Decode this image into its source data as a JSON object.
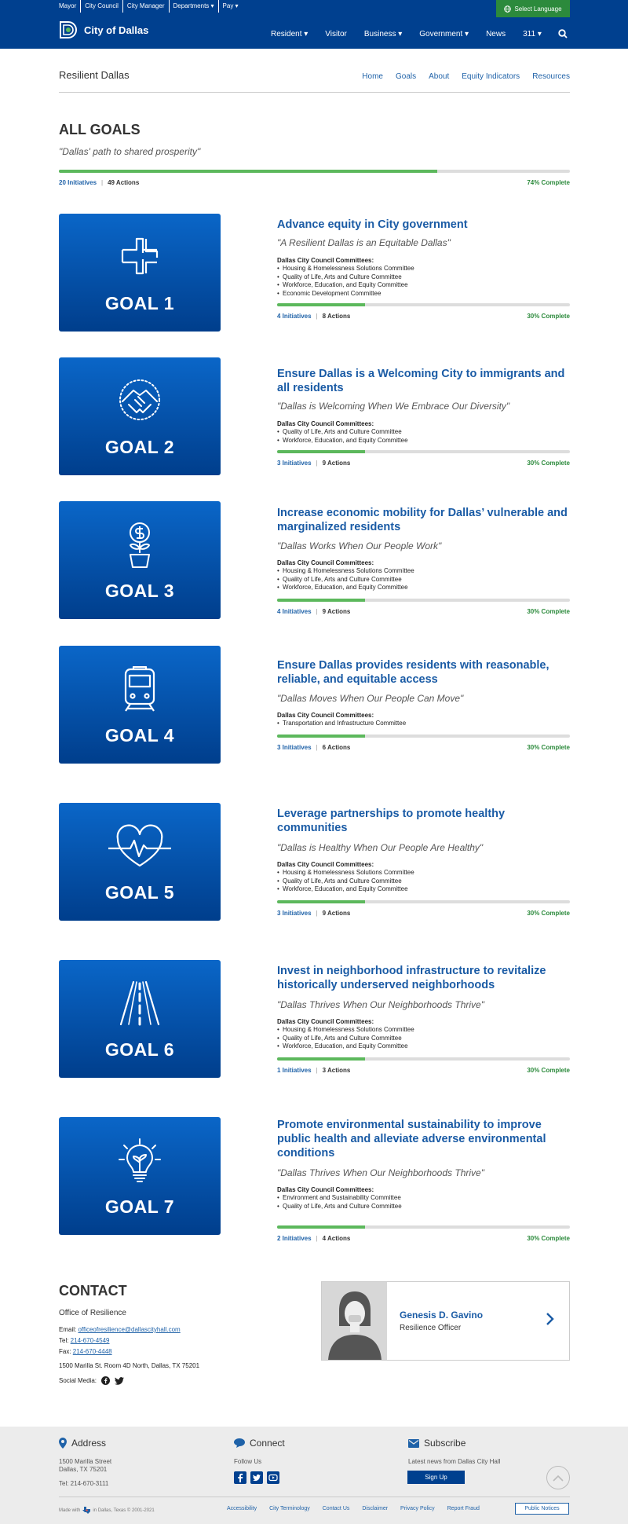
{
  "topbar": {
    "util_links": [
      "Mayor",
      "City Council",
      "City Manager",
      "Departments ▾",
      "Pay ▾"
    ],
    "language_button": "Select Language",
    "logo_text": "City of Dallas",
    "nav": [
      "Resident ▾",
      "Visitor",
      "Business ▾",
      "Government ▾",
      "News",
      "311 ▾"
    ]
  },
  "subnav": {
    "title": "Resilient Dallas",
    "links": [
      "Home",
      "Goals",
      "About",
      "Equity Indicators",
      "Resources"
    ]
  },
  "overview": {
    "heading": "ALL GOALS",
    "tagline": "\"Dallas' path to shared prosperity\"",
    "initiatives": "20 Initiatives",
    "actions": "49 Actions",
    "progress": 0.74,
    "complete": "74% Complete"
  },
  "committee_label": "Dallas City Council Committees:",
  "goals": [
    {
      "label": "GOAL 1",
      "icon": "hands-icon",
      "title": "Advance equity in City government",
      "quote": "\"A Resilient Dallas is an Equitable Dallas\"",
      "committees": [
        "Housing & Homelessness Solutions Committee",
        "Quality of Life, Arts and Culture Committee",
        "Workforce, Education, and Equity Committee",
        "Economic Development Committee"
      ],
      "initiatives": "4 Initiatives",
      "actions": "8 Actions",
      "progress": 0.3,
      "complete": "30% Complete"
    },
    {
      "label": "GOAL 2",
      "icon": "handshake-icon",
      "title": "Ensure Dallas is a Welcoming City to immigrants and all residents",
      "quote": "\"Dallas is Welcoming When We Embrace Our Diversity\"",
      "committees": [
        "Quality of Life, Arts and Culture Committee",
        "Workforce, Education, and Equity Committee"
      ],
      "initiatives": "3 Initiatives",
      "actions": "9 Actions",
      "progress": 0.3,
      "complete": "30% Complete"
    },
    {
      "label": "GOAL 3",
      "icon": "money-plant-icon",
      "title": "Increase economic mobility for Dallas’ vulnerable and marginalized residents",
      "quote": "\"Dallas Works When Our People Work\"",
      "committees": [
        "Housing & Homelessness Solutions Committee",
        "Quality of Life, Arts and Culture Committee",
        "Workforce, Education, and Equity Committee"
      ],
      "initiatives": "4 Initiatives",
      "actions": "9 Actions",
      "progress": 0.3,
      "complete": "30% Complete"
    },
    {
      "label": "GOAL 4",
      "icon": "train-icon",
      "title": "Ensure Dallas provides residents with reasonable, reliable, and equitable access",
      "quote": "\"Dallas Moves When Our People Can Move\"",
      "committees": [
        "Transportation and Infrastructure Committee"
      ],
      "initiatives": "3 Initiatives",
      "actions": "6 Actions",
      "progress": 0.3,
      "complete": "30% Complete"
    },
    {
      "label": "GOAL 5",
      "icon": "heartbeat-icon",
      "title": "Leverage partnerships to promote healthy communities",
      "quote": "\"Dallas is Healthy When Our People Are Healthy\"",
      "committees": [
        "Housing & Homelessness Solutions Committee",
        "Quality of Life, Arts and Culture Committee",
        "Workforce, Education, and Equity Committee"
      ],
      "initiatives": "3 Initiatives",
      "actions": "9 Actions",
      "progress": 0.3,
      "complete": "30% Complete"
    },
    {
      "label": "GOAL 6",
      "icon": "road-icon",
      "title": "Invest in neighborhood infrastructure to revitalize historically underserved neighborhoods",
      "quote": "\"Dallas Thrives When Our Neighborhoods Thrive\"",
      "committees": [
        "Housing & Homelessness Solutions Committee",
        "Quality of Life, Arts and Culture Committee",
        "Workforce, Education, and Equity Committee"
      ],
      "initiatives": "1 Initiatives",
      "actions": "3 Actions",
      "progress": 0.3,
      "complete": "30% Complete"
    },
    {
      "label": "GOAL 7",
      "icon": "lightbulb-leaf-icon",
      "title": "Promote environmental sustainability to improve public health and alleviate adverse environmental conditions",
      "quote": "\"Dallas Thrives When Our Neighborhoods Thrive\"",
      "committees": [
        "Environment and Sustainability Committee",
        "Quality of Life, Arts and Culture Committee"
      ],
      "initiatives": "2 Initiatives",
      "actions": "4 Actions",
      "progress": 0.3,
      "complete": "30% Complete"
    }
  ],
  "contact": {
    "heading": "CONTACT",
    "office": "Office of Resilience",
    "email_label": "Email: ",
    "email": "officeofresilience@dallascityhall.com",
    "tel_label": "Tel: ",
    "tel": "214-670-4549",
    "fax_label": "Fax: ",
    "fax": "214-670-4448",
    "address": "1500 Marilla St. Room 4D North, Dallas, TX 75201",
    "social_label": "Social Media:",
    "person_name": "Genesis D. Gavino",
    "person_role": "Resilience Officer"
  },
  "footer": {
    "address_h": "Address",
    "address_1": "1500 Marilla Street",
    "address_2": "Dallas, TX 75201",
    "tel": "Tel: 214-670-3111",
    "connect_h": "Connect",
    "follow": "Follow Us",
    "subscribe_h": "Subscribe",
    "subscribe_text": "Latest news from Dallas City Hall",
    "signup": "Sign Up",
    "made_with": "Made with",
    "made_rest": "in Dallas, Texas © 2001-2021",
    "links": [
      "Accessibility",
      "City Terminology",
      "Contact Us",
      "Disclaimer",
      "Privacy Policy",
      "Report Fraud"
    ],
    "public_notices": "Public Notices"
  },
  "colors": {
    "brand": "#00408f",
    "accent_green": "#5cb85c",
    "link": "#1f62a8"
  }
}
